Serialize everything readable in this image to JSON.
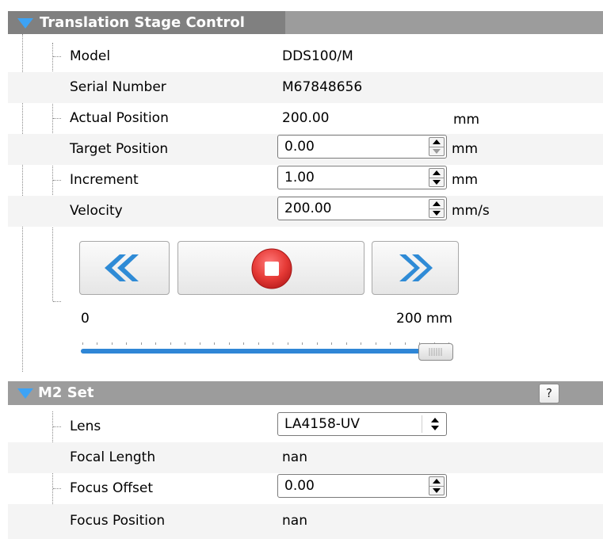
{
  "stage_section": {
    "title": "Translation Stage Control",
    "rows": [
      {
        "label": "Model",
        "value": "DDS100/M"
      },
      {
        "label": "Serial Number",
        "value": "M67848656"
      },
      {
        "label": "Actual Position",
        "value": "200.00",
        "unit": "mm"
      },
      {
        "label": "Target Position",
        "value": "0.00",
        "unit": "mm"
      },
      {
        "label": "Increment",
        "value": "1.00",
        "unit": "mm"
      },
      {
        "label": "Velocity",
        "value": "200.00",
        "unit": "mm/s"
      }
    ],
    "buttons": {
      "move_back_icon": "double-chevron-left-icon",
      "stop_icon": "stop-icon",
      "move_forward_icon": "double-chevron-right-icon"
    },
    "slider": {
      "min_label": "0",
      "max_label": "200 mm",
      "value_fraction": 1.0
    }
  },
  "m2_section": {
    "title": "M2 Set",
    "help_label": "?",
    "rows": [
      {
        "label": "Lens",
        "value": "LA4158-UV"
      },
      {
        "label": "Focal Length",
        "value": "nan"
      },
      {
        "label": "Focus Offset",
        "value": "0.00"
      },
      {
        "label": "Focus Position",
        "value": "nan"
      }
    ]
  },
  "colors": {
    "header_bg": "#9c9c9c",
    "header_title_bg": "#808080",
    "expand_triangle": "#3da3f5",
    "arrow_blue": "#2f8bd6",
    "stop_red": "#e53935",
    "slider_blue": "#2f86d6"
  }
}
